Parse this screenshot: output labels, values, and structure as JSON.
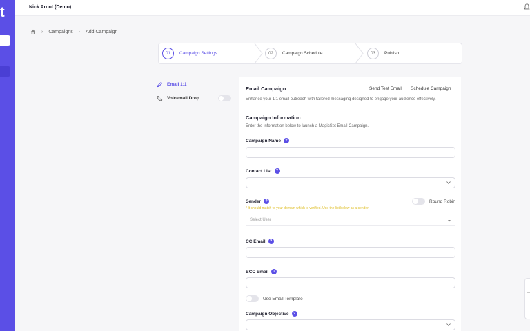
{
  "app": {
    "logo_fragment": "t",
    "user_name": "Nick Arnot (Demo)"
  },
  "breadcrumb": {
    "items": [
      "Campaigns",
      "Add Campaign"
    ]
  },
  "stepper": {
    "steps": [
      {
        "num": "01",
        "label": "Campaign Settings",
        "active": true
      },
      {
        "num": "02",
        "label": "Campaign Schedule",
        "active": false
      },
      {
        "num": "03",
        "label": "Publish",
        "active": false
      }
    ]
  },
  "side_menu": {
    "items": [
      {
        "label": "Email 1:1",
        "icon": "pencil-icon",
        "active": true
      },
      {
        "label": "Voicemail Drop",
        "icon": "phone-icon",
        "active": false
      }
    ]
  },
  "main": {
    "email_campaign_title": "Email Campaign",
    "send_test_label": "Send Test Email",
    "schedule_label": "Schedule Campaign",
    "email_campaign_desc": "Enhance your 1:1 email outreach with tailored messaging designed to engage your audience effectively.",
    "info_title": "Campaign Information",
    "info_desc": "Enter the information below to launch a MagicSet Email Campaign.",
    "fields": {
      "campaign_name": "Campaign Name",
      "contact_list": "Contact List",
      "sender": "Sender",
      "cc_email": "CC Email",
      "bcc_email": "BCC Email",
      "campaign_objective": "Campaign Objective"
    },
    "round_robin_label": "Round Robin",
    "sender_warning": "* It should match to your domain which is verified. Use the list below as a sender.",
    "select_user_placeholder": "Select User",
    "template_label": "Use Email Template"
  },
  "colors": {
    "accent": "#5b4fe6",
    "warning": "#d9b300"
  }
}
